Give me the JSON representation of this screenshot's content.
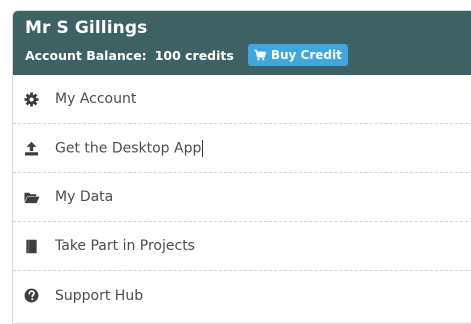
{
  "account": {
    "user_name": "Mr S Gillings",
    "balance_label": "Account Balance:",
    "balance_value": "100 credits",
    "buy_credit_label": "Buy Credit",
    "buy_credit_icon": "shopping-cart-icon"
  },
  "menu": {
    "items": [
      {
        "label": "My Account",
        "icon": "gear-icon"
      },
      {
        "label": "Get the Desktop App",
        "icon": "upload-icon"
      },
      {
        "label": "My Data",
        "icon": "folder-open-icon"
      },
      {
        "label": "Take Part in Projects",
        "icon": "book-icon"
      },
      {
        "label": "Support Hub",
        "icon": "question-circle-icon"
      }
    ]
  },
  "colors": {
    "header_bg": "#3e6263",
    "button_bg": "#3ea7dc",
    "text": "#4a4d4f",
    "icon": "#3b3f41"
  }
}
